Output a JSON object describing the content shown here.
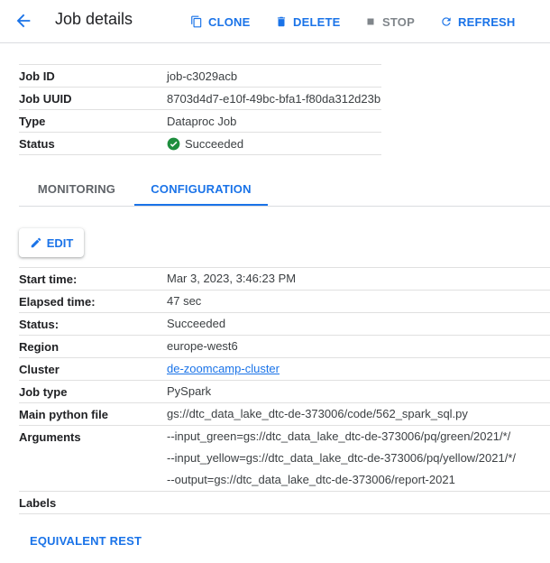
{
  "header": {
    "title": "Job details",
    "clone": "CLONE",
    "delete": "DELETE",
    "stop": "STOP",
    "refresh": "REFRESH"
  },
  "summary": [
    {
      "label": "Job ID",
      "value": "job-c3029acb"
    },
    {
      "label": "Job UUID",
      "value": "8703d4d7-e10f-49bc-bfa1-f80da312d23b"
    },
    {
      "label": "Type",
      "value": "Dataproc Job"
    },
    {
      "label": "Status",
      "value": "Succeeded"
    }
  ],
  "tabs": [
    {
      "label": "MONITORING"
    },
    {
      "label": "CONFIGURATION"
    }
  ],
  "edit_label": "EDIT",
  "config": {
    "start_time": {
      "label": "Start time:",
      "value": "Mar 3, 2023, 3:46:23 PM"
    },
    "elapsed_time": {
      "label": "Elapsed time:",
      "value": "47 sec"
    },
    "status": {
      "label": "Status:",
      "value": "Succeeded"
    },
    "region": {
      "label": "Region",
      "value": "europe-west6"
    },
    "cluster": {
      "label": "Cluster",
      "value": "de-zoomcamp-cluster"
    },
    "job_type": {
      "label": "Job type",
      "value": "PySpark"
    },
    "main_python_file": {
      "label": "Main python file",
      "value": "gs://dtc_data_lake_dtc-de-373006/code/562_spark_sql.py"
    },
    "arguments": {
      "label": "Arguments",
      "values": [
        "--input_green=gs://dtc_data_lake_dtc-de-373006/pq/green/2021/*/",
        "--input_yellow=gs://dtc_data_lake_dtc-de-373006/pq/yellow/2021/*/",
        "--output=gs://dtc_data_lake_dtc-de-373006/report-2021"
      ]
    },
    "labels": {
      "label": "Labels",
      "value": ""
    }
  },
  "equivalent_rest": "EQUIVALENT REST",
  "colors": {
    "accent": "#1a73e8",
    "success": "#1e8e3e",
    "disabled": "#80868b"
  }
}
